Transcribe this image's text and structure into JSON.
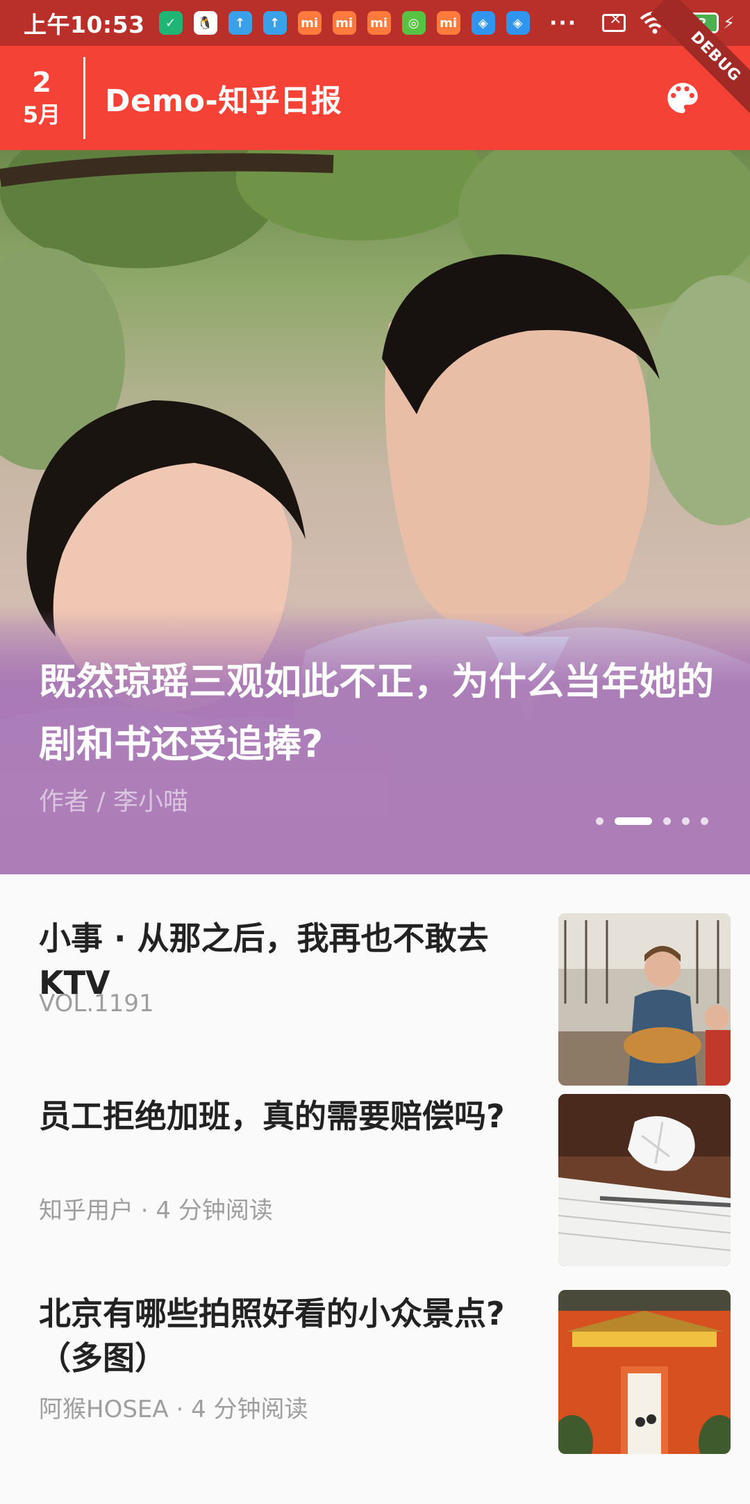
{
  "status_bar": {
    "time": "上午10:53",
    "more": "···",
    "battery": "82",
    "notif_icons": [
      {
        "name": "shield-app-icon",
        "bg": "#1fb574",
        "glyph": "✓"
      },
      {
        "name": "qq-icon",
        "bg": "#ffffff",
        "glyph": "🐧"
      },
      {
        "name": "upload-icon",
        "bg": "#3aa0e8",
        "glyph": "↑"
      },
      {
        "name": "upload-icon-2",
        "bg": "#3aa0e8",
        "glyph": "↑"
      },
      {
        "name": "mi-store-icon",
        "bg": "#ff7a3c",
        "glyph": "mi"
      },
      {
        "name": "mi-icon",
        "bg": "#ff7a3c",
        "glyph": "mi"
      },
      {
        "name": "mi-store-icon-2",
        "bg": "#ff7a3c",
        "glyph": "mi"
      },
      {
        "name": "android-icon",
        "bg": "#58c242",
        "glyph": "◎"
      },
      {
        "name": "mi-icon-2",
        "bg": "#ff7a3c",
        "glyph": "mi"
      },
      {
        "name": "browser-icon",
        "bg": "#2f95ef",
        "glyph": "◈"
      },
      {
        "name": "browser-icon-2",
        "bg": "#2f95ef",
        "glyph": "◈"
      }
    ]
  },
  "app_bar": {
    "day": "2",
    "month": "5月",
    "title": "Demo-知乎日报",
    "debug": "DEBUG",
    "accent": "#f44336"
  },
  "hero": {
    "title": "既然琼瑶三观如此不正，为什么当年她的剧和书还受追捧?",
    "author": "作者 / 李小喵",
    "indicator_count": 5,
    "active_index": 1
  },
  "stories": [
    {
      "title": "小事 · 从那之后，我再也不敢去 KTV",
      "meta": "VOL.1191",
      "thumb": "singer-photo"
    },
    {
      "title": "员工拒绝加班，真的需要赔偿吗?",
      "meta": "知乎用户 · 4 分钟阅读",
      "thumb": "notebook-photo"
    },
    {
      "title": "北京有哪些拍照好看的小众景点? （多图）",
      "meta": "阿猴HOSEA · 4 分钟阅读",
      "thumb": "palace-photo"
    }
  ]
}
